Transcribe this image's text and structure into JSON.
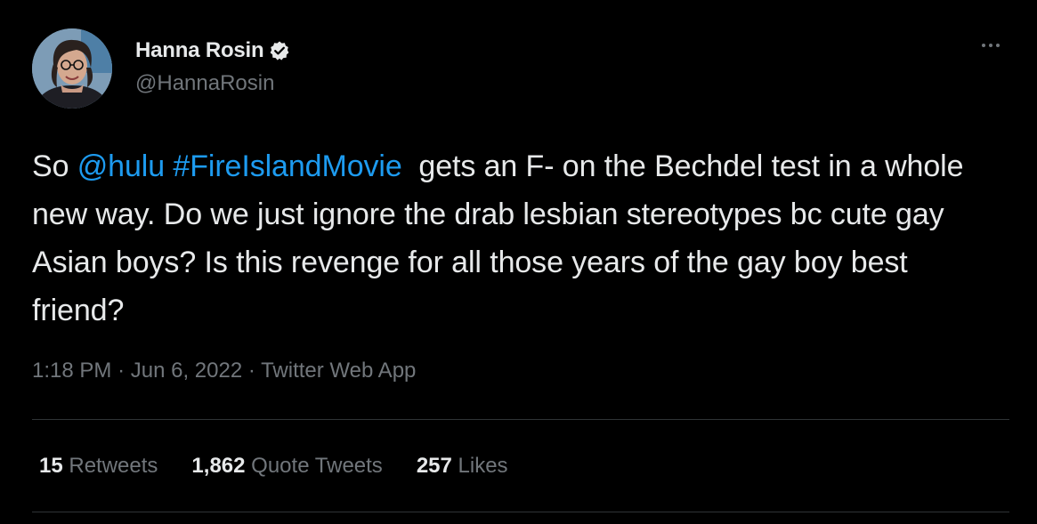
{
  "author": {
    "display_name": "Hanna Rosin",
    "handle": "@HannaRosin",
    "verified_icon": "verified-badge-icon",
    "avatar": "avatar-photo"
  },
  "tweet": {
    "text_parts": [
      {
        "text": "So ",
        "type": "text"
      },
      {
        "text": "@hulu",
        "type": "mention"
      },
      {
        "text": " ",
        "type": "text"
      },
      {
        "text": "#FireIslandMovie",
        "type": "hashtag"
      },
      {
        "text": "  gets an F- on the Bechdel test in a whole new way. Do we just ignore the drab lesbian stereotypes bc cute gay Asian boys? Is this revenge for all those years of the gay boy best friend?",
        "type": "text"
      }
    ],
    "time": "1:18 PM",
    "date": "Jun 6, 2022",
    "source": "Twitter Web App",
    "separator": "·"
  },
  "stats": {
    "retweets": {
      "count": "15",
      "label": "Retweets"
    },
    "quote_tweets": {
      "count": "1,862",
      "label": "Quote Tweets"
    },
    "likes": {
      "count": "257",
      "label": "Likes"
    }
  },
  "menu": {
    "icon": "more-options-icon"
  },
  "colors": {
    "background": "#000000",
    "text": "#e7e9ea",
    "secondary": "#71767b",
    "link": "#1d9bf0",
    "divider": "#2f3336"
  }
}
